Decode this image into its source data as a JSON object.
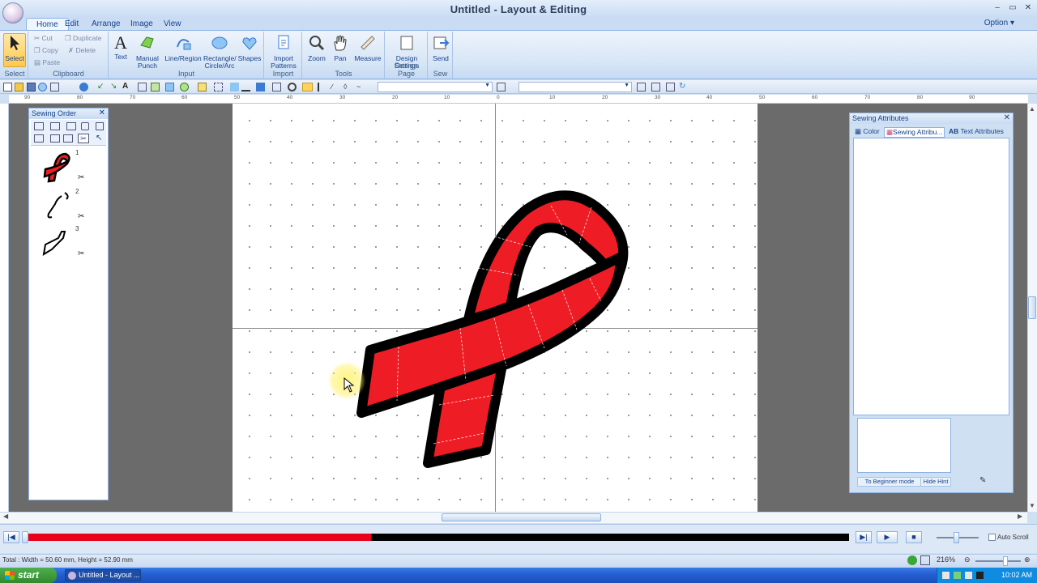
{
  "window": {
    "title": "Untitled - Layout & Editing",
    "options_label": "Option"
  },
  "tabs": [
    {
      "label": "Home"
    },
    {
      "label": "Edit"
    },
    {
      "label": "Arrange"
    },
    {
      "label": "Image"
    },
    {
      "label": "View"
    }
  ],
  "ribbon": {
    "select": {
      "button": "Select",
      "group": "Select"
    },
    "clipboard": {
      "cut": "Cut",
      "copy": "Copy",
      "paste": "Paste",
      "duplicate": "Duplicate",
      "delete": "Delete",
      "group": "Clipboard"
    },
    "input": {
      "text": "Text",
      "manual_punch": "Manual Punch",
      "line_region": "Line/Region",
      "rect_circle": "Rectangle/ Circle/Arc",
      "shapes": "Shapes",
      "group": "Input"
    },
    "import": {
      "import_patterns": "Import Patterns",
      "group": "Import"
    },
    "tools": {
      "zoom": "Zoom",
      "pan": "Pan",
      "measure": "Measure",
      "group": "Tools"
    },
    "design_page": {
      "design_settings": "Design Settings",
      "group": "Design Page"
    },
    "sew": {
      "send": "Send",
      "group": "Sew"
    }
  },
  "ruler": {
    "h_labels": [
      "90",
      "80",
      "70",
      "60",
      "50",
      "40",
      "30",
      "20",
      "10",
      "0",
      "10",
      "20",
      "30",
      "40",
      "50",
      "60",
      "70",
      "80",
      "90"
    ]
  },
  "sewing_order": {
    "title": "Sewing Order",
    "items": [
      {
        "num": "1"
      },
      {
        "num": "2"
      },
      {
        "num": "3"
      }
    ]
  },
  "sewing_attributes": {
    "title": "Sewing Attributes",
    "tabs": [
      "Color",
      "Sewing Attribu...",
      "Text Attributes"
    ],
    "beginner_button": "To Beginner mode",
    "hide_hint_button": "Hide Hint"
  },
  "playback": {
    "progress": 0.42,
    "auto_scroll_label": "Auto Scroll"
  },
  "status": {
    "dimensions": "Total : Width = 50.60 mm, Height = 52.90 mm",
    "zoom": "216%"
  },
  "taskbar": {
    "start": "start",
    "task_item": "Untitled - Layout ...",
    "clock": "10:02 AM"
  },
  "colors": {
    "ribbon_fill": "#ee1c24",
    "outline": "#000000",
    "workspace": "#6b6b6b",
    "accent": "#15428b"
  }
}
